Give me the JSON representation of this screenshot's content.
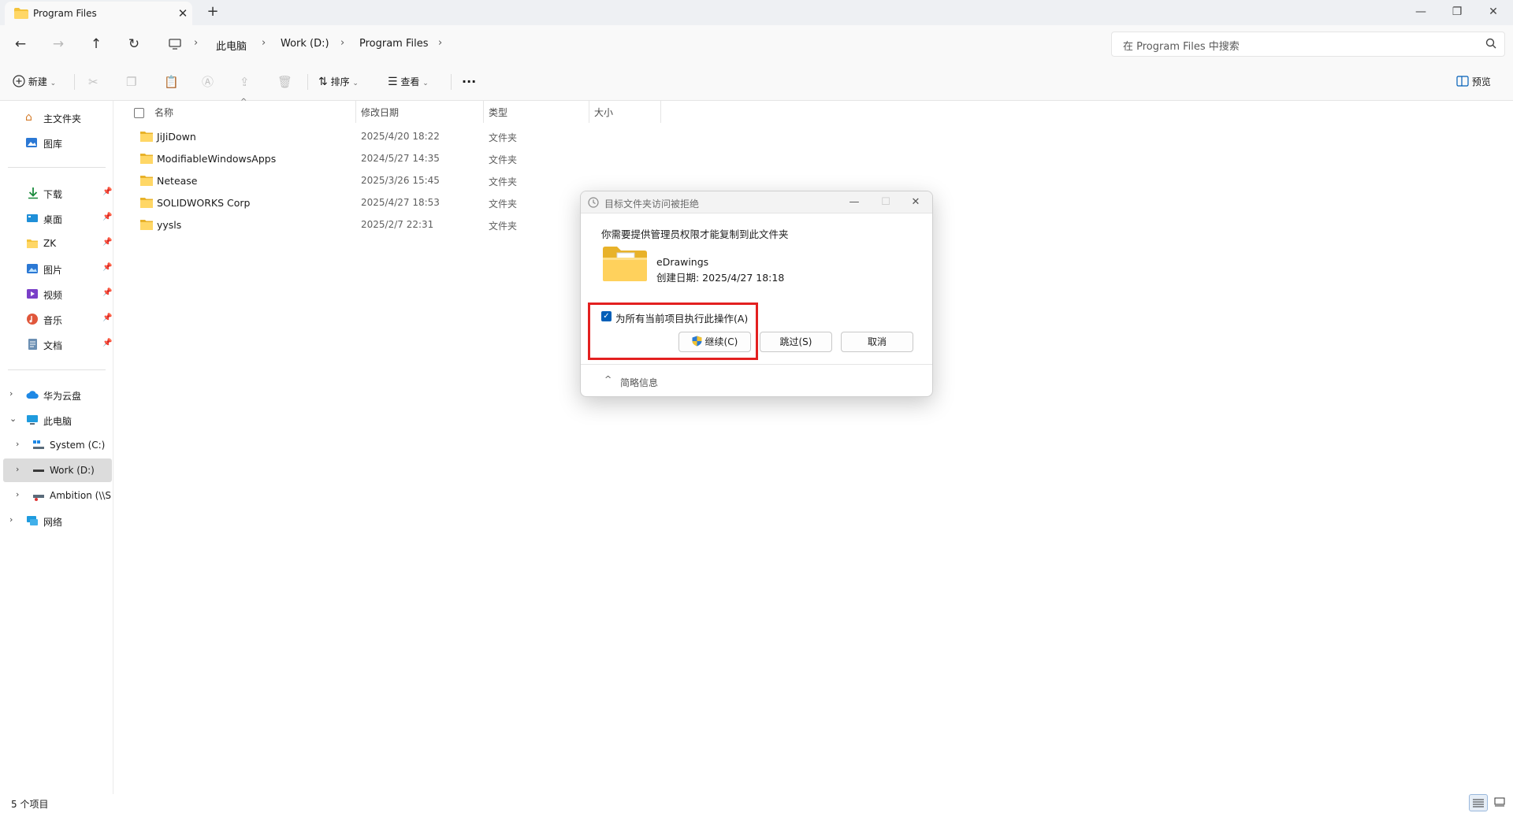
{
  "window": {
    "tab_title": "Program Files",
    "tab_close": "✕",
    "tab_add": "+",
    "minimize": "—",
    "maximize": "❐",
    "close": "✕"
  },
  "nav": {
    "back": "←",
    "forward": "→",
    "up": "↑",
    "refresh": "↻"
  },
  "breadcrumb": {
    "items": [
      "此电脑",
      "Work (D:)",
      "Program Files"
    ],
    "separator": "›"
  },
  "search": {
    "placeholder": "在 Program Files 中搜索"
  },
  "toolbar": {
    "new_label": "新建",
    "sort_label": "排序",
    "view_label": "查看",
    "more": "···",
    "preview_label": "预览",
    "dropdown": "⌄"
  },
  "sidebar": {
    "home": "主文件夹",
    "gallery": "图库",
    "quick": [
      {
        "label": "下载",
        "icon": "download-icon"
      },
      {
        "label": "桌面",
        "icon": "desktop-icon"
      },
      {
        "label": "ZK",
        "icon": "folder-icon"
      },
      {
        "label": "图片",
        "icon": "pictures-icon"
      },
      {
        "label": "视频",
        "icon": "videos-icon"
      },
      {
        "label": "音乐",
        "icon": "music-icon"
      },
      {
        "label": "文档",
        "icon": "documents-icon"
      }
    ],
    "pin": "📌",
    "cloud": "华为云盘",
    "this_pc": "此电脑",
    "drives": [
      "System (C:)",
      "Work (D:)",
      "Ambition (\\\\SI"
    ],
    "network": "网络",
    "chev_right": "›",
    "chev_down": "⌄"
  },
  "filelist": {
    "columns": [
      "名称",
      "修改日期",
      "类型",
      "大小"
    ],
    "sort_arrow": "^",
    "rows": [
      {
        "name": "JiJiDown",
        "date": "2025/4/20 18:22",
        "type": "文件夹"
      },
      {
        "name": "ModifiableWindowsApps",
        "date": "2024/5/27 14:35",
        "type": "文件夹"
      },
      {
        "name": "Netease",
        "date": "2025/3/26 15:45",
        "type": "文件夹"
      },
      {
        "name": "SOLIDWORKS Corp",
        "date": "2025/4/27 18:53",
        "type": "文件夹"
      },
      {
        "name": "yysls",
        "date": "2025/2/7 22:31",
        "type": "文件夹"
      }
    ]
  },
  "status": {
    "count": "5 个项目"
  },
  "dialog": {
    "title": "目标文件夹访问被拒绝",
    "message": "你需要提供管理员权限才能复制到此文件夹",
    "file_name": "eDrawings",
    "file_date": "创建日期: 2025/4/27 18:18",
    "checkbox_label": "为所有当前项目执行此操作(A)",
    "checkbox_checked": true,
    "continue_label": "继续(C)",
    "skip_label": "跳过(S)",
    "cancel_label": "取消",
    "details_label": "简略信息",
    "details_chev": "^",
    "close": "✕",
    "minimize": "—",
    "maximize": "☐"
  },
  "colors": {
    "accent": "#005fb8",
    "highlight": "#e32020",
    "folder": "#f4c33a"
  }
}
